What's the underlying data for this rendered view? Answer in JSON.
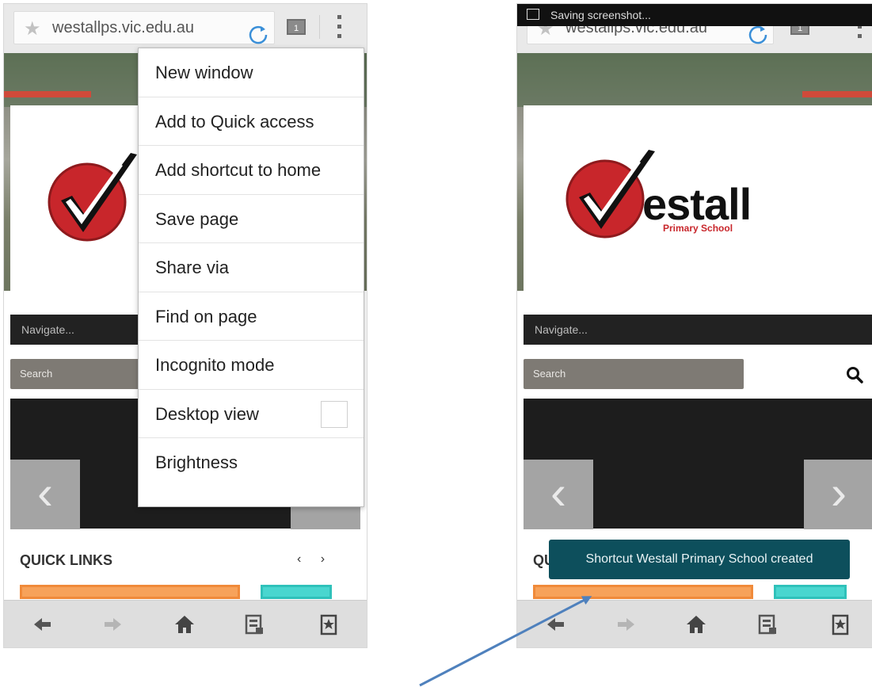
{
  "browser": {
    "url": "westallps.vic.edu.au",
    "tab_count": "1"
  },
  "left_screen": {
    "navigate_placeholder": "Navigate...",
    "search_placeholder": "Search",
    "quick_links_title": "QUICK LINKS",
    "quick_links_arrows": "‹ ›",
    "slider_prev": "‹",
    "slider_next": "›",
    "menu": {
      "items": [
        {
          "label": "New window"
        },
        {
          "label": "Add to Quick access"
        },
        {
          "label": "Add shortcut to home"
        },
        {
          "label": "Save page"
        },
        {
          "label": "Share via"
        },
        {
          "label": "Find on page"
        },
        {
          "label": "Incognito mode"
        },
        {
          "label": "Desktop view",
          "checkbox": false
        },
        {
          "label": "Brightness"
        }
      ]
    }
  },
  "right_screen": {
    "status_notification": "Saving screenshot...",
    "logo_word": "estall",
    "logo_subtitle": "Primary School",
    "navigate_placeholder": "Navigate...",
    "search_placeholder": "Search",
    "quick_links_title_partial": "QU",
    "slider_prev": "‹",
    "slider_next": "›",
    "toast": "Shortcut Westall Primary School created"
  },
  "colors": {
    "logo_red": "#c8262b",
    "toast_bg": "#0d4f5c",
    "annotation_arrow": "#4f81bd",
    "tile_orange": "#f7a25a",
    "tile_teal": "#49d6cf"
  },
  "toolbar_icons": [
    "back-icon",
    "forward-icon",
    "home-icon",
    "tabs-list-icon",
    "bookmark-icon"
  ]
}
